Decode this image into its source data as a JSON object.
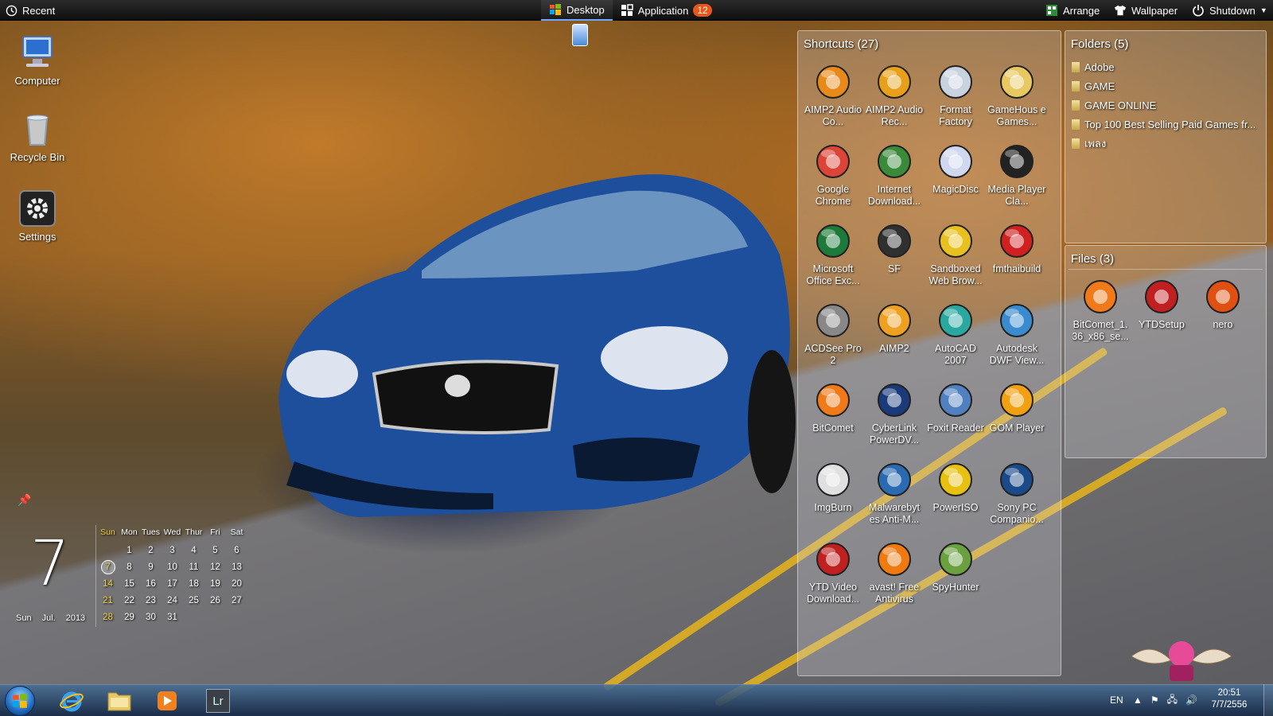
{
  "topbar": {
    "recent": "Recent",
    "desktop_tab": "Desktop",
    "application_tab": "Application",
    "application_count": "12",
    "arrange": "Arrange",
    "wallpaper": "Wallpaper",
    "shutdown": "Shutdown"
  },
  "desktop_icons": [
    {
      "label": "Computer",
      "icon": "computer-icon"
    },
    {
      "label": "Recycle Bin",
      "icon": "recycle-bin-icon"
    },
    {
      "label": "Settings",
      "icon": "gear-icon"
    }
  ],
  "shortcuts": {
    "title": "Shortcuts (27)",
    "items": [
      {
        "label": "AIMP2 Audio Co...",
        "icon": "aimp-icon",
        "color": "#e88a1a"
      },
      {
        "label": "AIMP2 Audio Rec...",
        "icon": "aimp-record-icon",
        "color": "#e8a01a"
      },
      {
        "label": "Format Factory",
        "icon": "format-factory-icon",
        "color": "#c9d3e0"
      },
      {
        "label": "GameHous e Games...",
        "icon": "folder-icon",
        "color": "#e8c860"
      },
      {
        "label": "Google Chrome",
        "icon": "chrome-icon",
        "color": "#db4437"
      },
      {
        "label": "Internet Download...",
        "icon": "idm-icon",
        "color": "#3a8a3a"
      },
      {
        "label": "MagicDisc",
        "icon": "disc-icon",
        "color": "#d0d8f0"
      },
      {
        "label": "Media Player Cla...",
        "icon": "clapper-icon",
        "color": "#222222"
      },
      {
        "label": "Microsoft Office Exc...",
        "icon": "excel-icon",
        "color": "#1e7a3a"
      },
      {
        "label": "SF",
        "icon": "sf-icon",
        "color": "#303030"
      },
      {
        "label": "Sandboxed Web Brow...",
        "icon": "sandbox-icon",
        "color": "#e8c020"
      },
      {
        "label": "fmthaibuild",
        "icon": "tb-icon",
        "color": "#d02020"
      },
      {
        "label": "ACDSee Pro 2",
        "icon": "camera-icon",
        "color": "#888888"
      },
      {
        "label": "AIMP2",
        "icon": "aimp2-icon",
        "color": "#f0a020"
      },
      {
        "label": "AutoCAD 2007",
        "icon": "autocad-icon",
        "color": "#2aa8a0"
      },
      {
        "label": "Autodesk DWF View...",
        "icon": "globe-icon",
        "color": "#3a8ad0"
      },
      {
        "label": "BitComet",
        "icon": "bitcomet-icon",
        "color": "#f07a1a"
      },
      {
        "label": "CyberLink PowerDV...",
        "icon": "play-icon",
        "color": "#1a3a7a"
      },
      {
        "label": "Foxit Reader",
        "icon": "foxit-icon",
        "color": "#5080c0"
      },
      {
        "label": "GOM Player",
        "icon": "gom-icon",
        "color": "#f0a010"
      },
      {
        "label": "ImgBurn",
        "icon": "imgburn-icon",
        "color": "#e0e0e0"
      },
      {
        "label": "Malwarebyt es Anti-M...",
        "icon": "malwarebytes-icon",
        "color": "#2a6ab0"
      },
      {
        "label": "PowerISO",
        "icon": "poweriso-icon",
        "color": "#e8c010"
      },
      {
        "label": "Sony PC Companio...",
        "icon": "phone-icon",
        "color": "#1a4a8a"
      },
      {
        "label": "YTD Video Download...",
        "icon": "ytd-icon",
        "color": "#c02020"
      },
      {
        "label": "avast! Free Antivirus",
        "icon": "avast-icon",
        "color": "#f07a10"
      },
      {
        "label": "SpyHunter",
        "icon": "spyhunter-icon",
        "color": "#6aa040"
      }
    ]
  },
  "folders": {
    "title": "Folders (5)",
    "items": [
      "Adobe",
      "GAME",
      "GAME ONLINE",
      "Top 100 Best Selling Paid Games fr...",
      "เพลง"
    ]
  },
  "files": {
    "title": "Files (3)",
    "items": [
      {
        "label": "BitComet_1. 36_x86_se...",
        "icon": "bitcomet-icon",
        "color": "#f07a1a"
      },
      {
        "label": "YTDSetup",
        "icon": "ytd-icon",
        "color": "#c02020"
      },
      {
        "label": "nero",
        "icon": "nero-icon",
        "color": "#e05010"
      }
    ]
  },
  "clock_widget": {
    "day": "7",
    "weekday": "Sun",
    "month": "Jul.",
    "year": "2013"
  },
  "calendar": {
    "headers": [
      "Sun",
      "Mon",
      "Tues",
      "Wed",
      "Thur",
      "Fri",
      "Sat"
    ],
    "weeks": [
      [
        "",
        "1",
        "2",
        "3",
        "4",
        "5",
        "6"
      ],
      [
        "7",
        "8",
        "9",
        "10",
        "11",
        "12",
        "13"
      ],
      [
        "14",
        "15",
        "16",
        "17",
        "18",
        "19",
        "20"
      ],
      [
        "21",
        "22",
        "23",
        "24",
        "25",
        "26",
        "27"
      ],
      [
        "28",
        "29",
        "30",
        "31",
        "",
        "",
        ""
      ]
    ],
    "today": "7"
  },
  "taskbar": {
    "apps": [
      "internet-explorer-icon",
      "explorer-folder-icon",
      "media-player-icon",
      "lightroom-icon"
    ],
    "lightroom_label": "Lr",
    "language": "EN",
    "time": "20:51",
    "date": "7/7/2556"
  },
  "colors": {
    "accent": "#6fa8ff",
    "badge": "#e8561a",
    "sunday": "#f0d040"
  }
}
